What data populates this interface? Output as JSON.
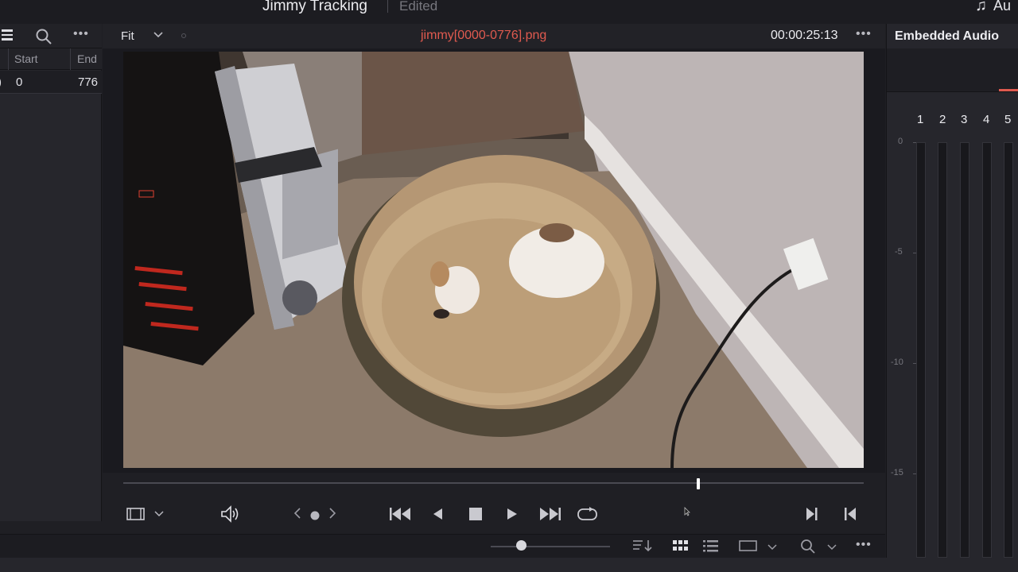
{
  "window": {
    "title": "Jimmy Tracking",
    "status": "Edited",
    "audio_short": "Au"
  },
  "media_pool": {
    "columns": [
      "Start",
      "End"
    ],
    "rows": [
      {
        "start": "0",
        "end": "776"
      }
    ]
  },
  "viewer": {
    "zoom": "Fit",
    "clip_name": "jimmy[0000-0776].png",
    "timecode": "00:00:25:13",
    "playhead_fraction": 0.777
  },
  "audio_panel": {
    "title": "Embedded Audio",
    "channels": [
      "1",
      "2",
      "3",
      "4",
      "5"
    ],
    "db_marks": [
      "0",
      "-5",
      "-10",
      "-15"
    ]
  },
  "bottom_toolbar": {
    "zoom_slider_fraction": 0.25
  },
  "colors": {
    "accent_red": "#e05a4f",
    "background": "#1f1f24"
  }
}
